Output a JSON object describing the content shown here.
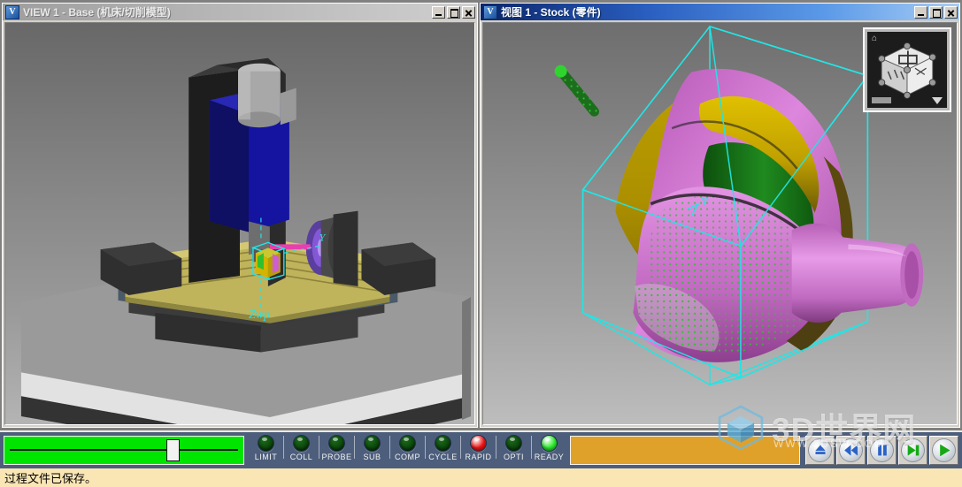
{
  "windows": {
    "left": {
      "title": "VIEW 1 - Base (机床/切削模型)",
      "icon": "vericut-app-icon",
      "state": "inactive",
      "buttons": {
        "minimize": "_",
        "maximize": "□",
        "close": "×"
      },
      "scene": {
        "axis_label": "Zwp",
        "description": "机床/切削模型"
      }
    },
    "right": {
      "title": "视图 1 - Stock (零件)",
      "icon": "vericut-app-icon",
      "state": "active",
      "buttons": {
        "minimize": "_",
        "maximize": "□",
        "close": "×"
      },
      "scene": {
        "axis_label": "Y",
        "description": "零件"
      },
      "viewcube": {
        "home_icon": "home-icon",
        "dropdown_icon": "chevron-down-icon"
      }
    }
  },
  "control_bar": {
    "slider": {
      "name": "speed-slider",
      "value": 73,
      "min": 0,
      "max": 100
    },
    "leds": [
      {
        "label": "LIMIT",
        "state": "off"
      },
      {
        "label": "COLL",
        "state": "off"
      },
      {
        "label": "PROBE",
        "state": "off"
      },
      {
        "label": "SUB",
        "state": "off"
      },
      {
        "label": "COMP",
        "state": "off"
      },
      {
        "label": "CYCLE",
        "state": "off"
      },
      {
        "label": "RAPID",
        "state": "red"
      },
      {
        "label": "OPTI",
        "state": "off"
      },
      {
        "label": "READY",
        "state": "green"
      }
    ],
    "progress": {
      "name": "run-progress",
      "value": 100
    },
    "transport": [
      {
        "name": "eject-button",
        "icon": "eject-triangle-icon",
        "color": "#2b62c6"
      },
      {
        "name": "rewind-button",
        "icon": "rewind-double-left-icon",
        "color": "#2b62c6"
      },
      {
        "name": "pause-button",
        "icon": "pause-bars-icon",
        "color": "#2b62c6"
      },
      {
        "name": "step-button",
        "icon": "step-forward-icon",
        "color": "#16a816"
      },
      {
        "name": "play-button",
        "icon": "play-triangle-icon",
        "color": "#16a816"
      }
    ]
  },
  "status_bar": {
    "message": "过程文件已保存。"
  },
  "watermark": {
    "title": "3D世界网",
    "subtitle": "WWW.3DSW.COM"
  },
  "colors": {
    "active_title_start": "#0a246a",
    "active_title_end": "#a9cdf5",
    "toolbar_bg": "#4d5e7c",
    "status_bg": "#fae6b4",
    "slider_green": "#00e500",
    "progress_orange": "#e0a12a",
    "led_red": "#ef1414",
    "led_green": "#2bee2b",
    "led_off": "#0c4a0c",
    "stock_magenta": "#d06ed0",
    "stock_yellow": "#d8b400",
    "stock_green": "#1e7a1e",
    "wireframe_cyan": "#22e5e5"
  }
}
